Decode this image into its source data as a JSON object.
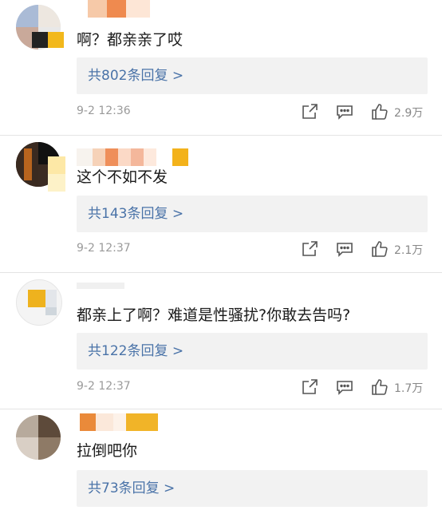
{
  "comments": [
    {
      "text": "啊？都亲亲了哎",
      "replies": "共802条回复 >",
      "time": "9-2 12:36",
      "likes": "2.9万"
    },
    {
      "text": "这个不如不发",
      "replies": "共143条回复 >",
      "time": "9-2 12:37",
      "likes": "2.1万"
    },
    {
      "text": "都亲上了啊？难道是性骚扰?你敢去告吗?",
      "replies": "共122条回复 >",
      "time": "9-2 12:37",
      "likes": "1.7万"
    },
    {
      "text": "拉倒吧你",
      "replies": "共73条回复 >",
      "time": "",
      "likes": ""
    }
  ],
  "icons": {
    "share": "share-icon",
    "reply": "comment-icon",
    "like": "thumbs-up-icon"
  },
  "colors": {
    "reply_link": "#4a73a8",
    "reply_bg": "#f2f2f2",
    "meta_gray": "#9a9a9a"
  }
}
